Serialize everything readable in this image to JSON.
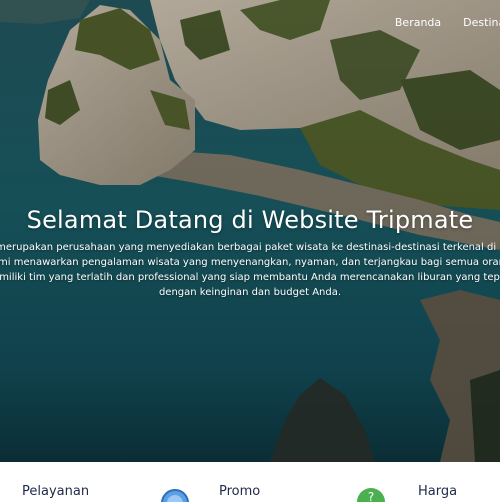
{
  "nav": {
    "items": [
      {
        "label": "Beranda"
      },
      {
        "label": "Destinasi"
      }
    ]
  },
  "hero": {
    "title": "Selamat Datang di Website Tripmate",
    "description_lines": [
      "Tripmate merupakan perusahaan yang menyediakan berbagai paket wisata ke destinasi-destinasi terkenal di Indonesia.",
      "Kami menawarkan pengalaman wisata yang menyenangkan, nyaman, dan terjangkau bagi semua orang.",
      "Kami memiliki tim yang terlatih dan professional yang siap membantu Anda merencanakan liburan yang tepat sesuai",
      "dengan keinginan dan budget Anda."
    ],
    "background_image": "rocky-cliffs-sea-icon"
  },
  "services": {
    "items": [
      {
        "label": "Pelayanan",
        "icon": "service-icon"
      },
      {
        "label": "Promo",
        "icon": "promo-icon"
      },
      {
        "label": "Harga",
        "icon": "price-icon"
      }
    ]
  },
  "colors": {
    "sea": "#17606a",
    "cliff": "#cfc4b2",
    "vegetation": "#4a5a2e",
    "text_dark": "#1f2a4a",
    "icon_blue": "#5aa0e6",
    "icon_green": "#4caf50"
  }
}
